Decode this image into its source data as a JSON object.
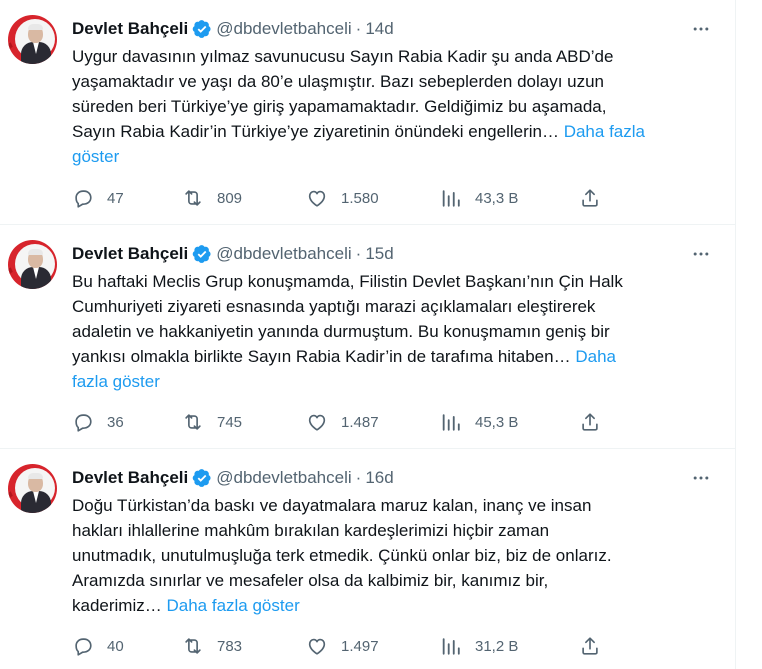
{
  "colors": {
    "accent": "#1d9bf0",
    "muted": "#536471",
    "text": "#0f1419",
    "divider": "#eff3f4"
  },
  "tweets": [
    {
      "name": "Devlet Bahçeli",
      "handle": "@dbdevletbahceli",
      "separator": "·",
      "time": "14d",
      "lines": [
        "Uygur davasının yılmaz savunucusu Sayın Rabia Kadir şu anda ABD’de",
        "yaşamaktadır ve yaşı da 80’e ulaşmıştır. Bazı sebeplerden dolayı uzun",
        "süreden beri Türkiye’ye giriş yapamamaktadır. Geldiğimiz bu aşamada,",
        "Sayın Rabia Kadir’in Türkiye’ye ziyaretinin önündeki engellerin…"
      ],
      "show_more_a": "Daha fazla",
      "show_more_b": "göster",
      "replies": "47",
      "reposts": "809",
      "likes": "1.580",
      "views": "43,3 B"
    },
    {
      "name": "Devlet Bahçeli",
      "handle": "@dbdevletbahceli",
      "separator": "·",
      "time": "15d",
      "lines": [
        "Bu haftaki Meclis Grup konuşmamda, Filistin Devlet Başkanı’nın Çin Halk",
        "Cumhuriyeti ziyareti esnasında yaptığı marazi açıklamaları eleştirerek",
        "adaletin ve hakkaniyetin yanında durmuştum. Bu konuşmamın geniş bir",
        "yankısı olmakla birlikte Sayın Rabia Kadir’in de tarafıma hitaben…"
      ],
      "show_more_a": "Daha",
      "show_more_b": "fazla göster",
      "replies": "36",
      "reposts": "745",
      "likes": "1.487",
      "views": "45,3 B"
    },
    {
      "name": "Devlet Bahçeli",
      "handle": "@dbdevletbahceli",
      "separator": "·",
      "time": "16d",
      "lines": [
        "Doğu Türkistan’da baskı ve dayatmalara maruz kalan, inanç ve insan",
        "hakları ihlallerine mahkûm bırakılan kardeşlerimizi hiçbir zaman",
        "unutmadık, unutulmuşluğa terk etmedik. Çünkü onlar biz, biz de onlarız.",
        "Aramızda sınırlar ve mesafeler olsa da kalbimiz bir, kanımız bir,",
        "kaderimiz…"
      ],
      "show_more": "Daha fazla göster",
      "replies": "40",
      "reposts": "783",
      "likes": "1.497",
      "views": "31,2 B"
    }
  ]
}
